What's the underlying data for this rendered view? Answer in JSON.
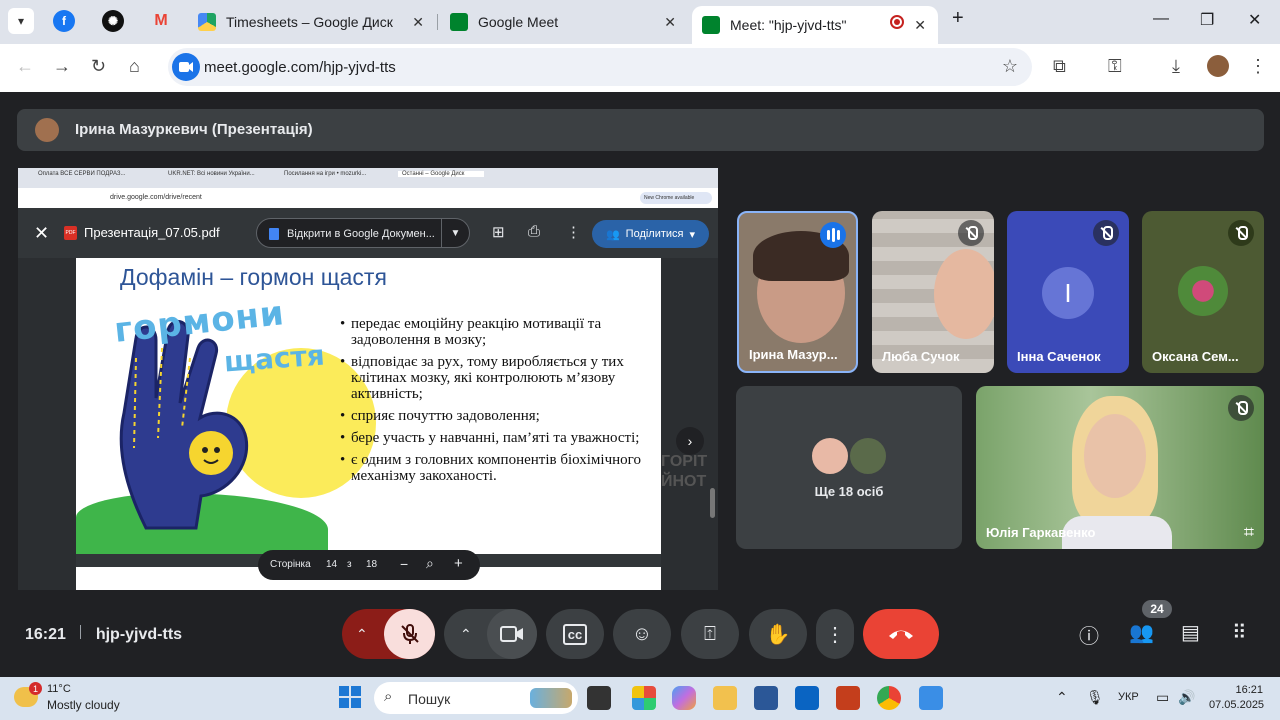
{
  "browser": {
    "tabs": [
      {
        "label": "Timesheets – Google Диск",
        "favicon_color": "#1fa463"
      },
      {
        "label": "Google Meet",
        "favicon_color": "#00832d"
      },
      {
        "label": "Meet: \"hjp-yjvd-tts\"",
        "favicon_color": "#00832d",
        "active": true
      }
    ],
    "pinned_tabs": [
      "facebook-icon",
      "chatgpt-icon",
      "gmail-icon"
    ],
    "url": "meet.google.com/hjp-yjvd-tts",
    "new_tab_symbol": "+"
  },
  "meet": {
    "presenter_label": "Ірина Мазуркевич (Презентація)",
    "meeting_time": "16:21",
    "meeting_code": "hjp-yjvd-tts",
    "participant_count": "24",
    "participants": [
      {
        "name": "Ірина Мазур...",
        "state": "speaking"
      },
      {
        "name": "Люба Сучок",
        "state": "muted"
      },
      {
        "name": "Інна Саченок",
        "state": "muted",
        "initial": "І"
      },
      {
        "name": "Оксана Сем...",
        "state": "muted"
      },
      {
        "name": "Юлія Гаркавенко",
        "state": "muted"
      }
    ],
    "others_label": "Ще 18 осіб"
  },
  "shared_screen": {
    "tabs": [
      "Оплата ВСЕ СЕРВИ ПОДРАЗ...",
      "UKR.NET: Всі новини України...",
      "Посилання на ігри • mozurki...",
      "Останні – Google Диск"
    ],
    "url": "drive.google.com/drive/recent",
    "chip": "New Chrome available",
    "file_name": "Презентація_07.05.pdf",
    "open_with": "Відкрити в Google Докумен...",
    "share_label": "Поділитися",
    "ghost_text": [
      "ГОРІТ",
      "ЙНОТ"
    ],
    "pager": {
      "label": "Сторінка",
      "current": "14",
      "of": "з",
      "total": "18"
    },
    "slide": {
      "title": "Дофамін – гормон щастя",
      "art_title": "гормони",
      "art_subtitle": "щастя",
      "bullets": [
        "передає емоційну реакцію мотивації та задоволення в мозку;",
        "відповідає за рух, тому виробляється у тих клітинах мозку, які контролюють м’язову активність;",
        "сприяє почуттю задоволення;",
        "бере участь у навчанні, пам’яті та уважності;",
        "є одним з головних компонентів біохімічного механізму закоханості."
      ]
    }
  },
  "taskbar": {
    "weather_temp": "11°C",
    "weather_desc": "Mostly cloudy",
    "weather_badge": "1",
    "search_placeholder": "Пошук",
    "language": "УКР",
    "time": "16:21",
    "date": "07.05.2025"
  },
  "colors": {
    "meet_bg": "#202124",
    "end_call": "#ea4335",
    "mic_off": "#f9dedc",
    "accent": "#1a73e8"
  }
}
